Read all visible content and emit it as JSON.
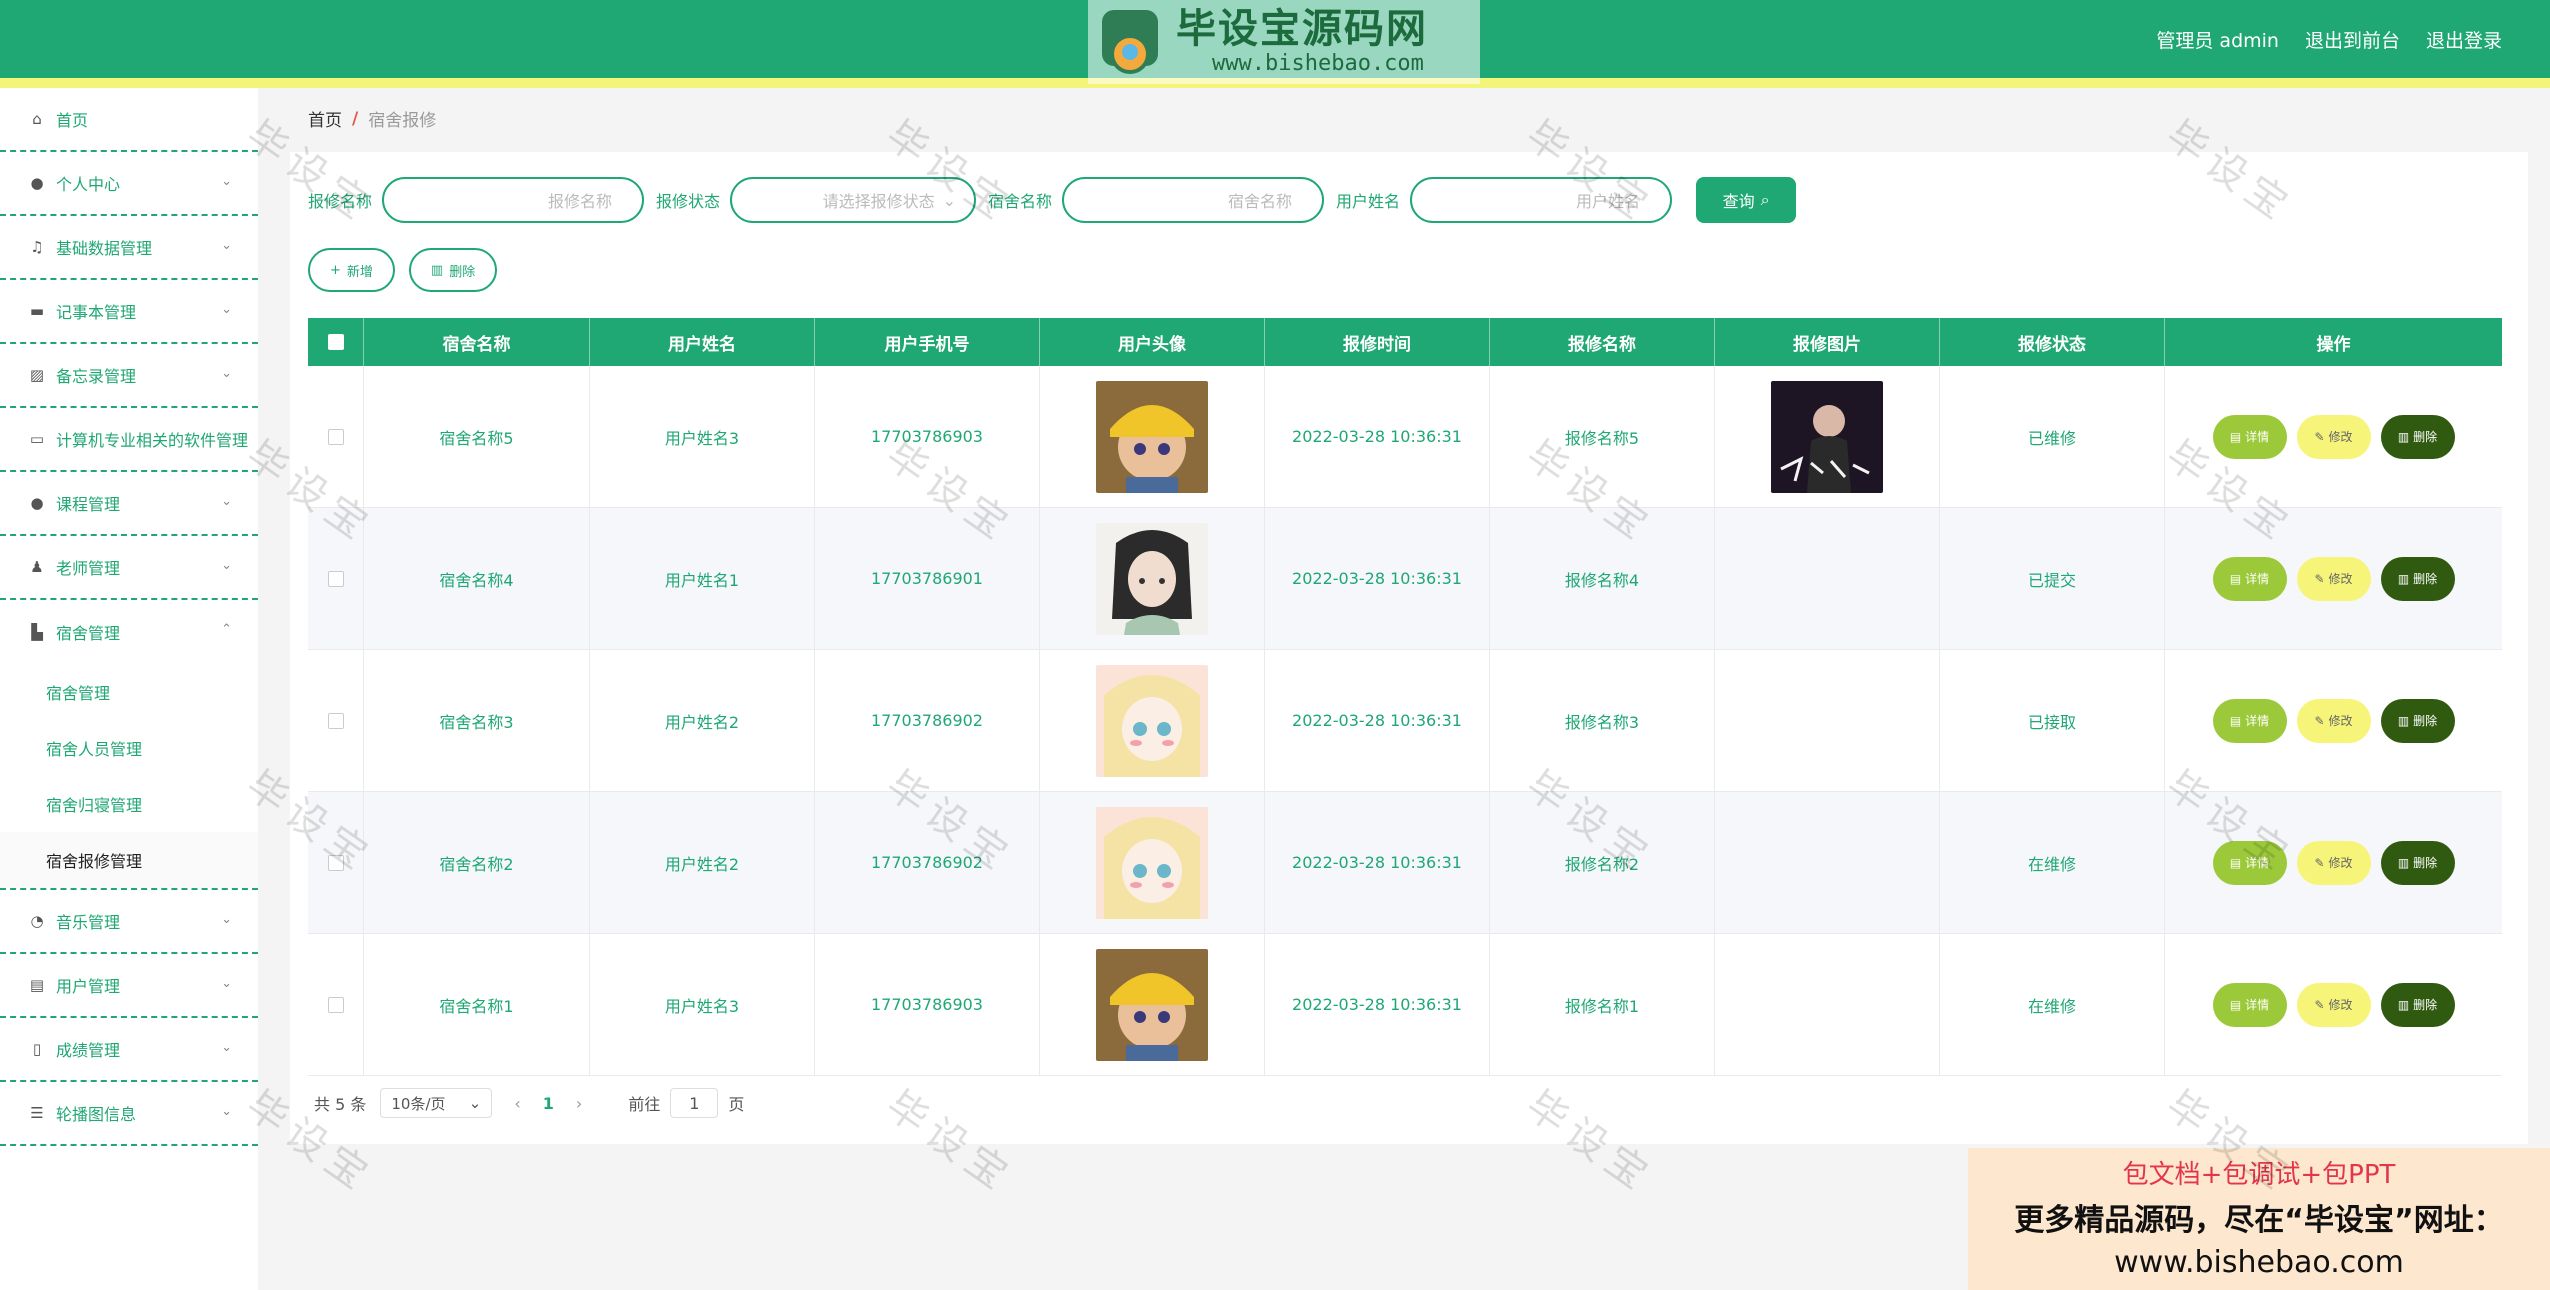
{
  "brand": {
    "logo_title": "毕设宝源码网",
    "logo_url": "www.bishebao.com",
    "logo_badge": "毕设宝"
  },
  "header": {
    "user": "管理员 admin",
    "to_front": "退出到前台",
    "logout": "退出登录"
  },
  "sidebar": {
    "items": [
      {
        "label": "首页",
        "icon": "home-icon"
      },
      {
        "label": "个人中心",
        "icon": "user-icon"
      },
      {
        "label": "基础数据管理",
        "icon": "bell-off-icon"
      },
      {
        "label": "记事本管理",
        "icon": "monitor-icon"
      },
      {
        "label": "备忘录管理",
        "icon": "chart-icon"
      },
      {
        "label": "计算机专业相关的软件管理",
        "icon": "chat-icon"
      },
      {
        "label": "课程管理",
        "icon": "user-icon"
      },
      {
        "label": "老师管理",
        "icon": "teacher-icon"
      },
      {
        "label": "宿舍管理",
        "icon": "bed-icon"
      },
      {
        "label": "音乐管理",
        "icon": "compass-icon"
      },
      {
        "label": "用户管理",
        "icon": "clipboard-icon"
      },
      {
        "label": "成绩管理",
        "icon": "phone-icon"
      },
      {
        "label": "轮播图信息",
        "icon": "sliders-icon"
      }
    ],
    "dorm_sub": [
      "宿舍管理",
      "宿舍人员管理",
      "宿舍归寝管理",
      "宿舍报修管理"
    ]
  },
  "breadcrumb": {
    "home": "首页",
    "sep": "/",
    "current": "宿舍报修"
  },
  "search": {
    "repair_name_label": "报修名称",
    "repair_name_placeholder": "报修名称",
    "repair_status_label": "报修状态",
    "repair_status_placeholder": "请选择报修状态",
    "dorm_name_label": "宿舍名称",
    "dorm_name_placeholder": "宿舍名称",
    "user_name_label": "用户姓名",
    "user_name_placeholder": "用户姓名",
    "query_button": "查询"
  },
  "actions": {
    "add": "新增",
    "delete": "删除"
  },
  "table": {
    "headers": [
      "宿舍名称",
      "用户姓名",
      "用户手机号",
      "用户头像",
      "报修时间",
      "报修名称",
      "报修图片",
      "报修状态",
      "操作"
    ],
    "rows": [
      {
        "dorm": "宿舍名称5",
        "user": "用户姓名3",
        "phone": "17703786903",
        "time": "2022-03-28 10:36:31",
        "repair": "报修名称5",
        "status": "已维修",
        "avatar": "boy-yellow-hat",
        "has_image": true
      },
      {
        "dorm": "宿舍名称4",
        "user": "用户姓名1",
        "phone": "17703786901",
        "time": "2022-03-28 10:36:31",
        "repair": "报修名称4",
        "status": "已提交",
        "avatar": "girl-dark-hair",
        "has_image": false
      },
      {
        "dorm": "宿舍名称3",
        "user": "用户姓名2",
        "phone": "17703786902",
        "time": "2022-03-28 10:36:31",
        "repair": "报修名称3",
        "status": "已接取",
        "avatar": "girl-blonde",
        "has_image": false
      },
      {
        "dorm": "宿舍名称2",
        "user": "用户姓名2",
        "phone": "17703786902",
        "time": "2022-03-28 10:36:31",
        "repair": "报修名称2",
        "status": "在维修",
        "avatar": "girl-blonde",
        "has_image": false
      },
      {
        "dorm": "宿舍名称1",
        "user": "用户姓名3",
        "phone": "17703786903",
        "time": "2022-03-28 10:36:31",
        "repair": "报修名称1",
        "status": "在维修",
        "avatar": "boy-yellow-hat",
        "has_image": false
      }
    ],
    "op_labels": {
      "detail": "详情",
      "edit": "修改",
      "delete": "删除"
    }
  },
  "pagination": {
    "total": "共 5 条",
    "page_size": "10条/页",
    "current_page": "1",
    "goto_label": "前往",
    "goto_value": "1",
    "page_unit": "页"
  },
  "ad": {
    "line1": "包文档+包调试+包PPT",
    "line2": "更多精品源码，尽在“毕设宝”网址：",
    "line3": "www.bishebao.com"
  },
  "watermark": "毕设宝",
  "colors": {
    "primary": "#1fa774",
    "stripe": "#f2f57a",
    "detail": "#9cc93a",
    "edit": "#f6f57a",
    "delete": "#2f5a10"
  }
}
